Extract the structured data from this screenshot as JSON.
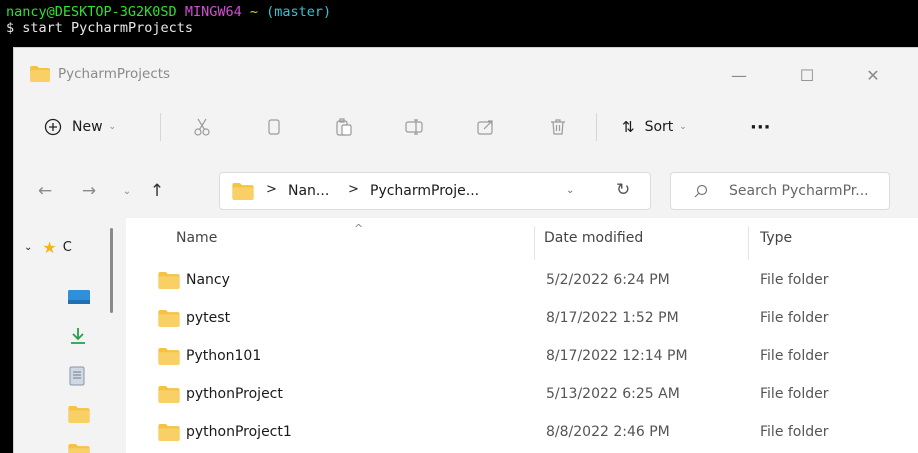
{
  "terminal": {
    "user_host": "nancy@DESKTOP-3G2K0SD",
    "env": "MINGW64",
    "tilde": "~",
    "branch": "(master)",
    "prompt": "$",
    "command": "start PycharmProjects"
  },
  "window": {
    "title": "PycharmProjects",
    "controls": {
      "minimize": "—",
      "maximize": "☐",
      "close": "✕"
    }
  },
  "toolbar": {
    "new_label": "New",
    "sort_label": "Sort",
    "more_label": "···"
  },
  "address": {
    "crumbs": [
      "Nan...",
      "PycharmProje..."
    ],
    "separator": ">"
  },
  "search": {
    "placeholder": "Search PycharmPr..."
  },
  "nav": {
    "quick_access_label": "C"
  },
  "columns": {
    "name": "Name",
    "date": "Date modified",
    "type": "Type"
  },
  "files": [
    {
      "name": "Nancy",
      "date": "5/2/2022 6:24 PM",
      "type": "File folder"
    },
    {
      "name": "pytest",
      "date": "8/17/2022 1:52 PM",
      "type": "File folder"
    },
    {
      "name": "Python101",
      "date": "8/17/2022 12:14 PM",
      "type": "File folder"
    },
    {
      "name": "pythonProject",
      "date": "5/13/2022 6:25 AM",
      "type": "File folder"
    },
    {
      "name": "pythonProject1",
      "date": "8/8/2022 2:46 PM",
      "type": "File folder"
    }
  ],
  "colors": {
    "folder": "#f5c242",
    "accent": "#0a7cd6",
    "terminal_green": "#2ee22e",
    "terminal_magenta": "#d14fd1",
    "terminal_yellow": "#d5d52a"
  }
}
